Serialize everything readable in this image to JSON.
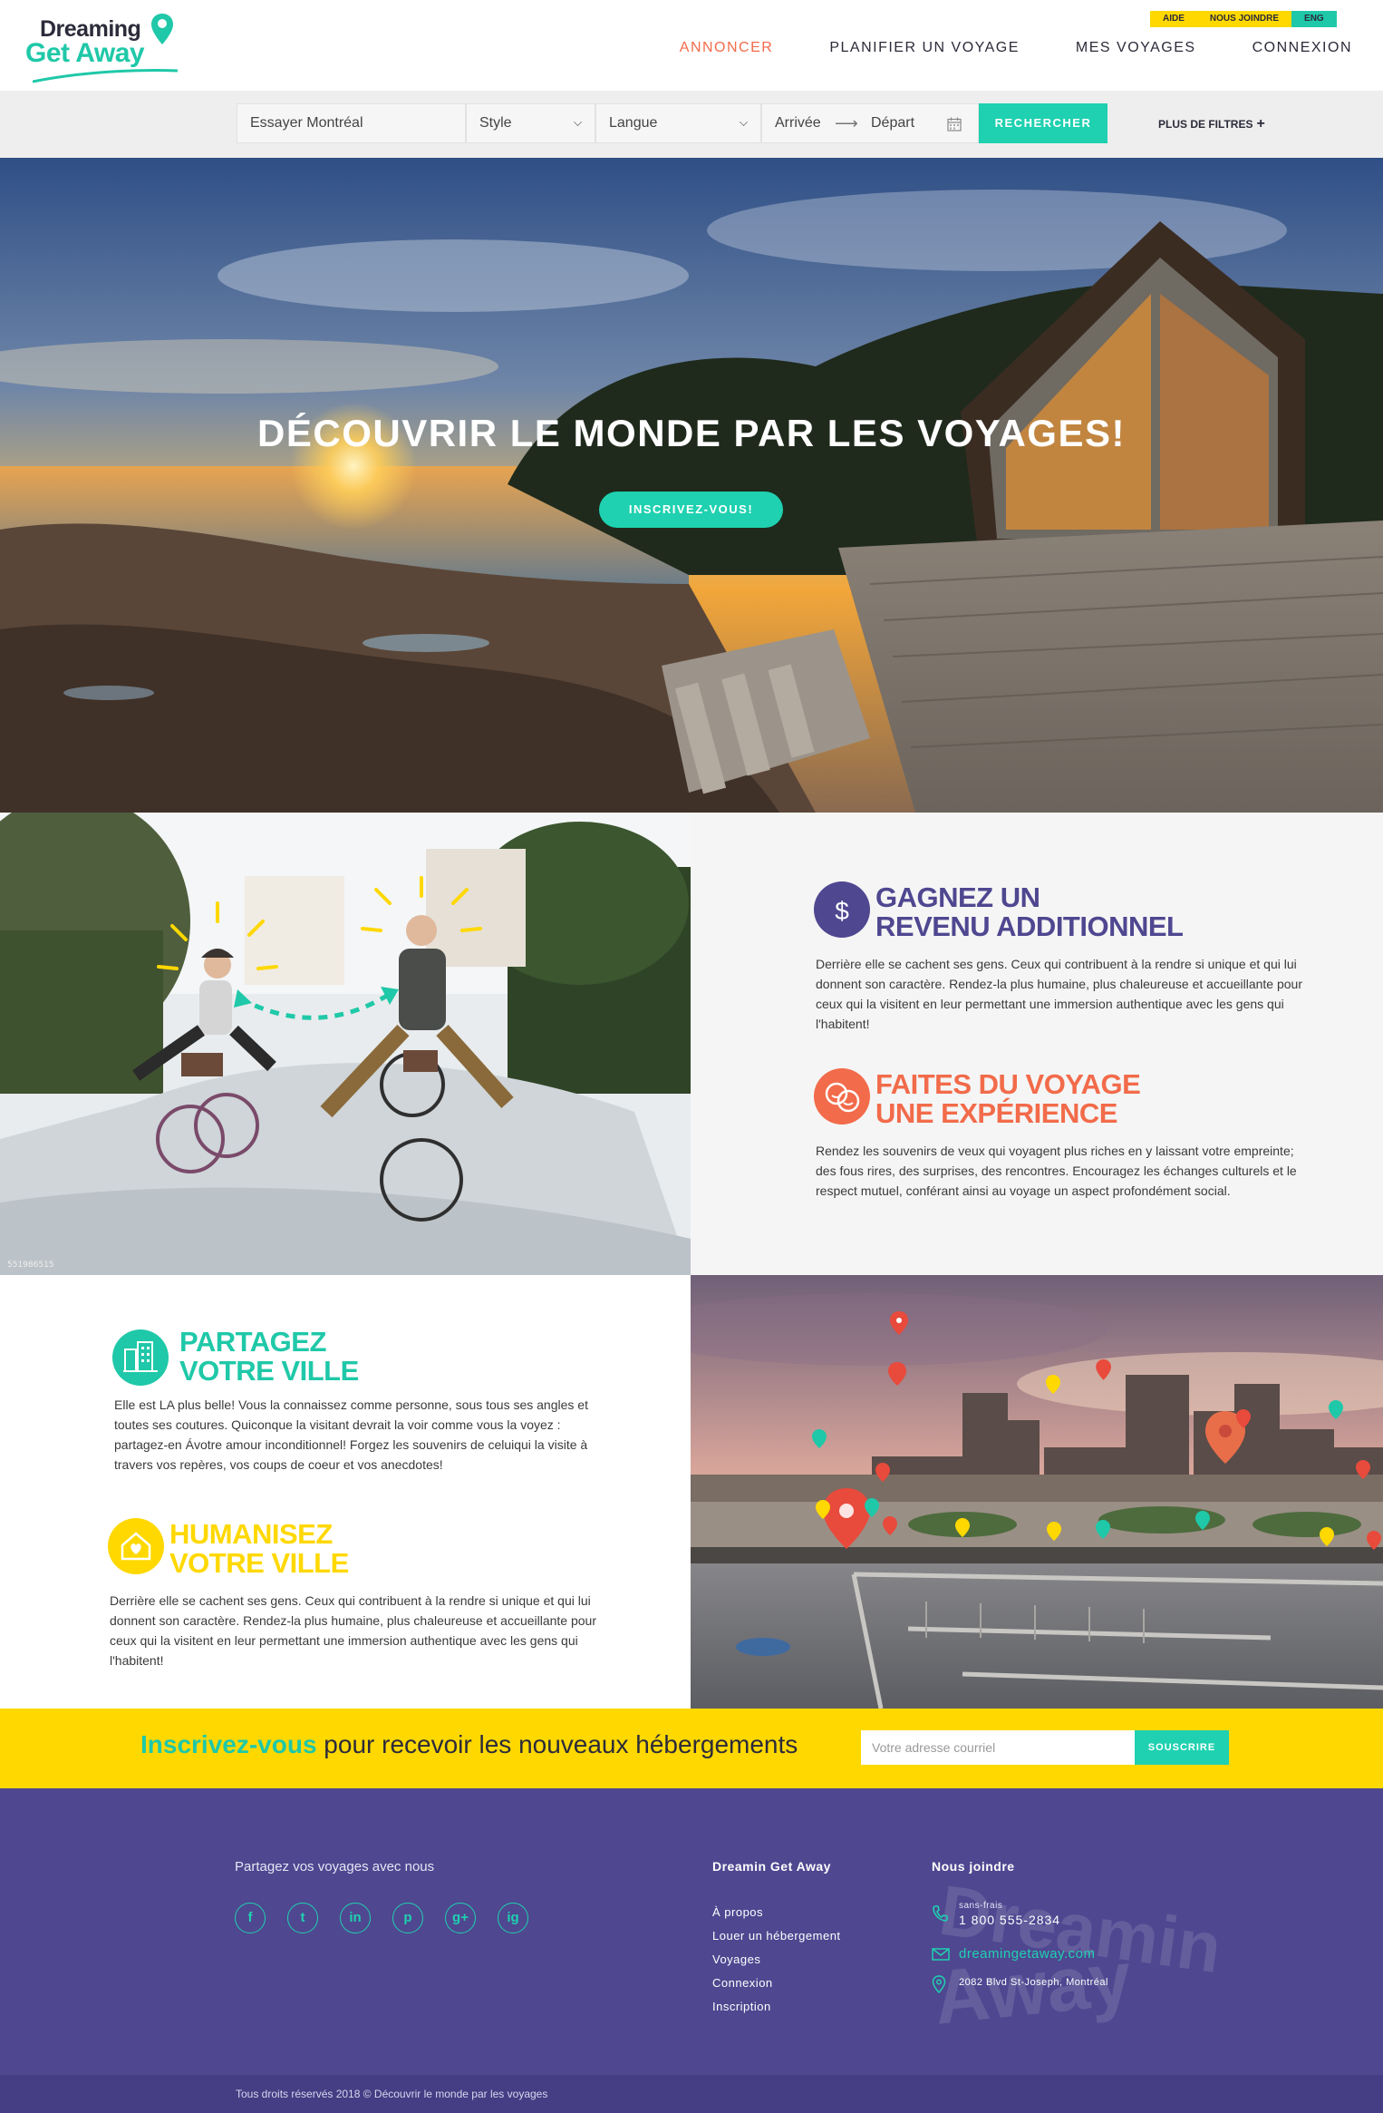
{
  "brand": {
    "line1": "Dreaming",
    "line2": "Get Away"
  },
  "top_links": {
    "aide": "AIDE",
    "join": "NOUS JOINDRE",
    "lang": "ENG"
  },
  "nav": {
    "annoncer": "ANNONCER",
    "planifier": "PLANIFIER UN VOYAGE",
    "mes_voyages": "MES VOYAGES",
    "connexion": "CONNEXION"
  },
  "search": {
    "where_placeholder": "Essayer Montréal",
    "style": "Style",
    "langue": "Langue",
    "arrivee": "Arrivée",
    "depart": "Départ",
    "button": "RECHERCHER",
    "more_filters": "PLUS DE FILTRES",
    "more_symbol": "+"
  },
  "hero": {
    "title": "DÉCOUVRIR LE MONDE PAR LES VOYAGES!",
    "cta": "INSCRIVEZ-VOUS!"
  },
  "photo_id": "551986515",
  "features": {
    "revenu": {
      "title1": "GAGNEZ UN",
      "title2": "REVENU ADDITIONNEL",
      "body": "Derrière elle se cachent ses gens. Ceux qui contribuent à la rendre si unique et qui lui donnent son caractère. Rendez-la plus humaine, plus chaleureuse et accueillante pour ceux qui la visitent en leur permettant une immersion authentique avec les gens qui l'habitent!",
      "color": "#4f4790"
    },
    "experience": {
      "title1": "FAITES DU VOYAGE",
      "title2": "UNE EXPÉRIENCE",
      "body": "Rendez les souvenirs de veux qui voyagent plus riches en y laissant votre empreinte; des fous rires, des surprises, des rencontres. Encouragez les échanges culturels et le respect mutuel, conférant ainsi au voyage un aspect profondément social.",
      "color": "#f26b4a"
    },
    "partagez": {
      "title1": "PARTAGEZ",
      "title2": "VOTRE VILLE",
      "body": "Elle est LA plus belle! Vous la connaissez comme personne, sous tous ses angles et toutes ses coutures. Quiconque la visitant devrait la voir comme vous la voyez : partagez-en Ávotre amour inconditionnel!  Forgez les souvenirs de celuiqui la visite à travers vos repères, vos coups de coeur et vos anecdotes!",
      "color": "#1fc8a8"
    },
    "humanisez": {
      "title1": "HUMANISEZ",
      "title2": "VOTRE VILLE",
      "body": "Derrière elle se cachent ses gens. Ceux qui contribuent à la rendre si unique et qui lui donnent son caractère. Rendez-la plus humaine, plus chaleureuse et accueillante pour ceux qui la visitent en leur permettant une immersion authentique avec les gens qui l'habitent!",
      "color": "#ffd800"
    }
  },
  "newsletter": {
    "highlight": "Inscrivez-vous",
    "text": " pour recevoir les nouveaux hébergements",
    "placeholder": "Votre adresse courriel",
    "button": "SOUSCRIRE"
  },
  "footer": {
    "tagline": "Partagez vos voyages avec nous",
    "socials": [
      "f",
      "t",
      "in",
      "p",
      "g+",
      "ig"
    ],
    "col1_title": "Dreamin Get Away",
    "links": [
      "À propos",
      "Louer un hébergement",
      "Voyages",
      "Connexion",
      "Inscription"
    ],
    "col2_title": "Nous joindre",
    "phone_label": "sans-frais",
    "phone": "1 800 555-2834",
    "email": "dreamingetaway.com",
    "address": "2082 Blvd St-Joseph, Montréal",
    "watermark1": "Dreamin",
    "watermark2": "Away"
  },
  "copyright": "Tous droits réservés 2018 © Découvrir le monde par les voyages",
  "colors": {
    "teal": "#1fd1b0",
    "yellow": "#ffd800",
    "purple": "#4f4790",
    "coral": "#f26b4a"
  }
}
